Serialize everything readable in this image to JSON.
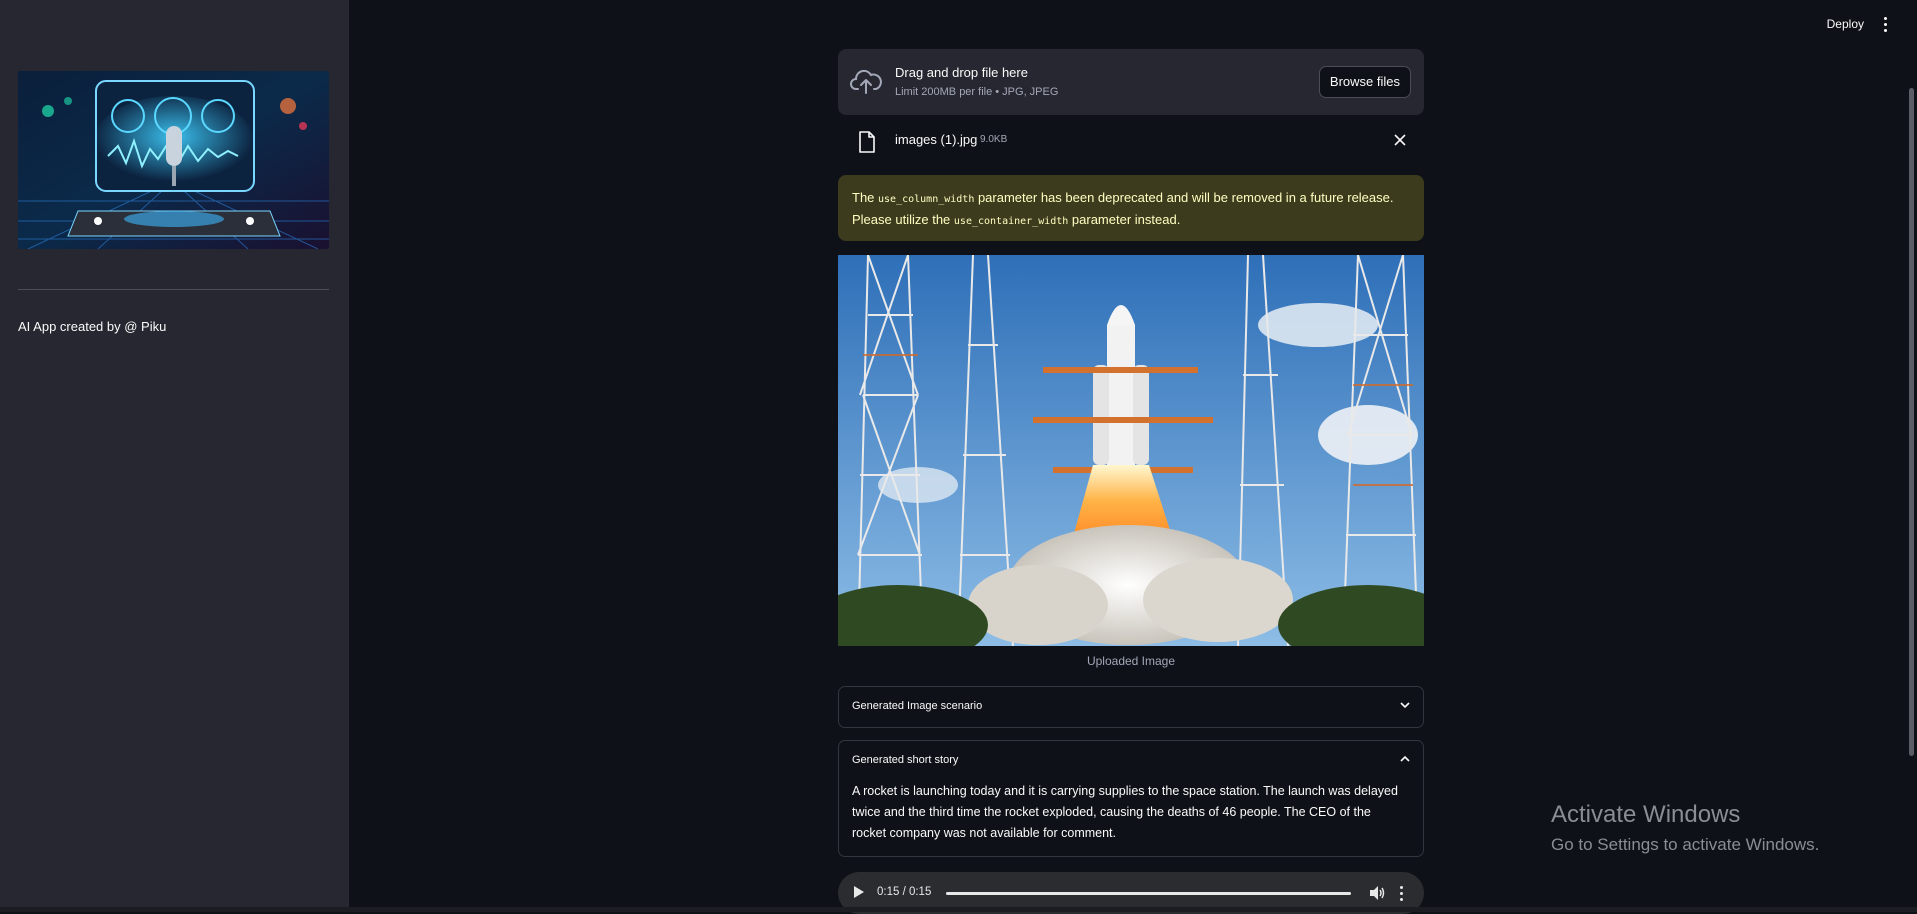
{
  "sidebar": {
    "caption": "AI App created by @ Piku"
  },
  "topbar": {
    "deploy_label": "Deploy"
  },
  "uploader": {
    "title": "Drag and drop file here",
    "subtitle": "Limit 200MB per file • JPG, JPEG",
    "browse_label": "Browse files",
    "file_name": "images (1).jpg",
    "file_size": "9.0KB"
  },
  "warning": {
    "text_1": "The ",
    "code_1": "use_column_width",
    "text_2": " parameter has been deprecated and will be removed in a future release. Please utilize the ",
    "code_2": "use_container_width",
    "text_3": " parameter instead."
  },
  "image": {
    "caption": "Uploaded Image"
  },
  "expanders": [
    {
      "title": "Generated Image scenario",
      "expanded": false
    },
    {
      "title": "Generated short story",
      "expanded": true,
      "body": "A rocket is launching today and it is carrying supplies to the space station. The launch was delayed twice and the third time the rocket exploded, causing the deaths of 46 people. The CEO of the rocket company was not available for comment."
    }
  ],
  "audio": {
    "time": "0:15 / 0:15",
    "progress": 1.0
  },
  "os_watermark": {
    "title": "Activate Windows",
    "subtitle": "Go to Settings to activate Windows."
  },
  "colors": {
    "background": "#0e1117",
    "sidebar": "#262730",
    "warning_bg": "#3d3b1d",
    "warning_text": "#ffffc2"
  },
  "icons": [
    "cloud-upload-icon",
    "file-icon",
    "close-icon",
    "chevron-down-icon",
    "chevron-up-icon",
    "play-icon",
    "volume-icon",
    "more-vert-icon"
  ]
}
